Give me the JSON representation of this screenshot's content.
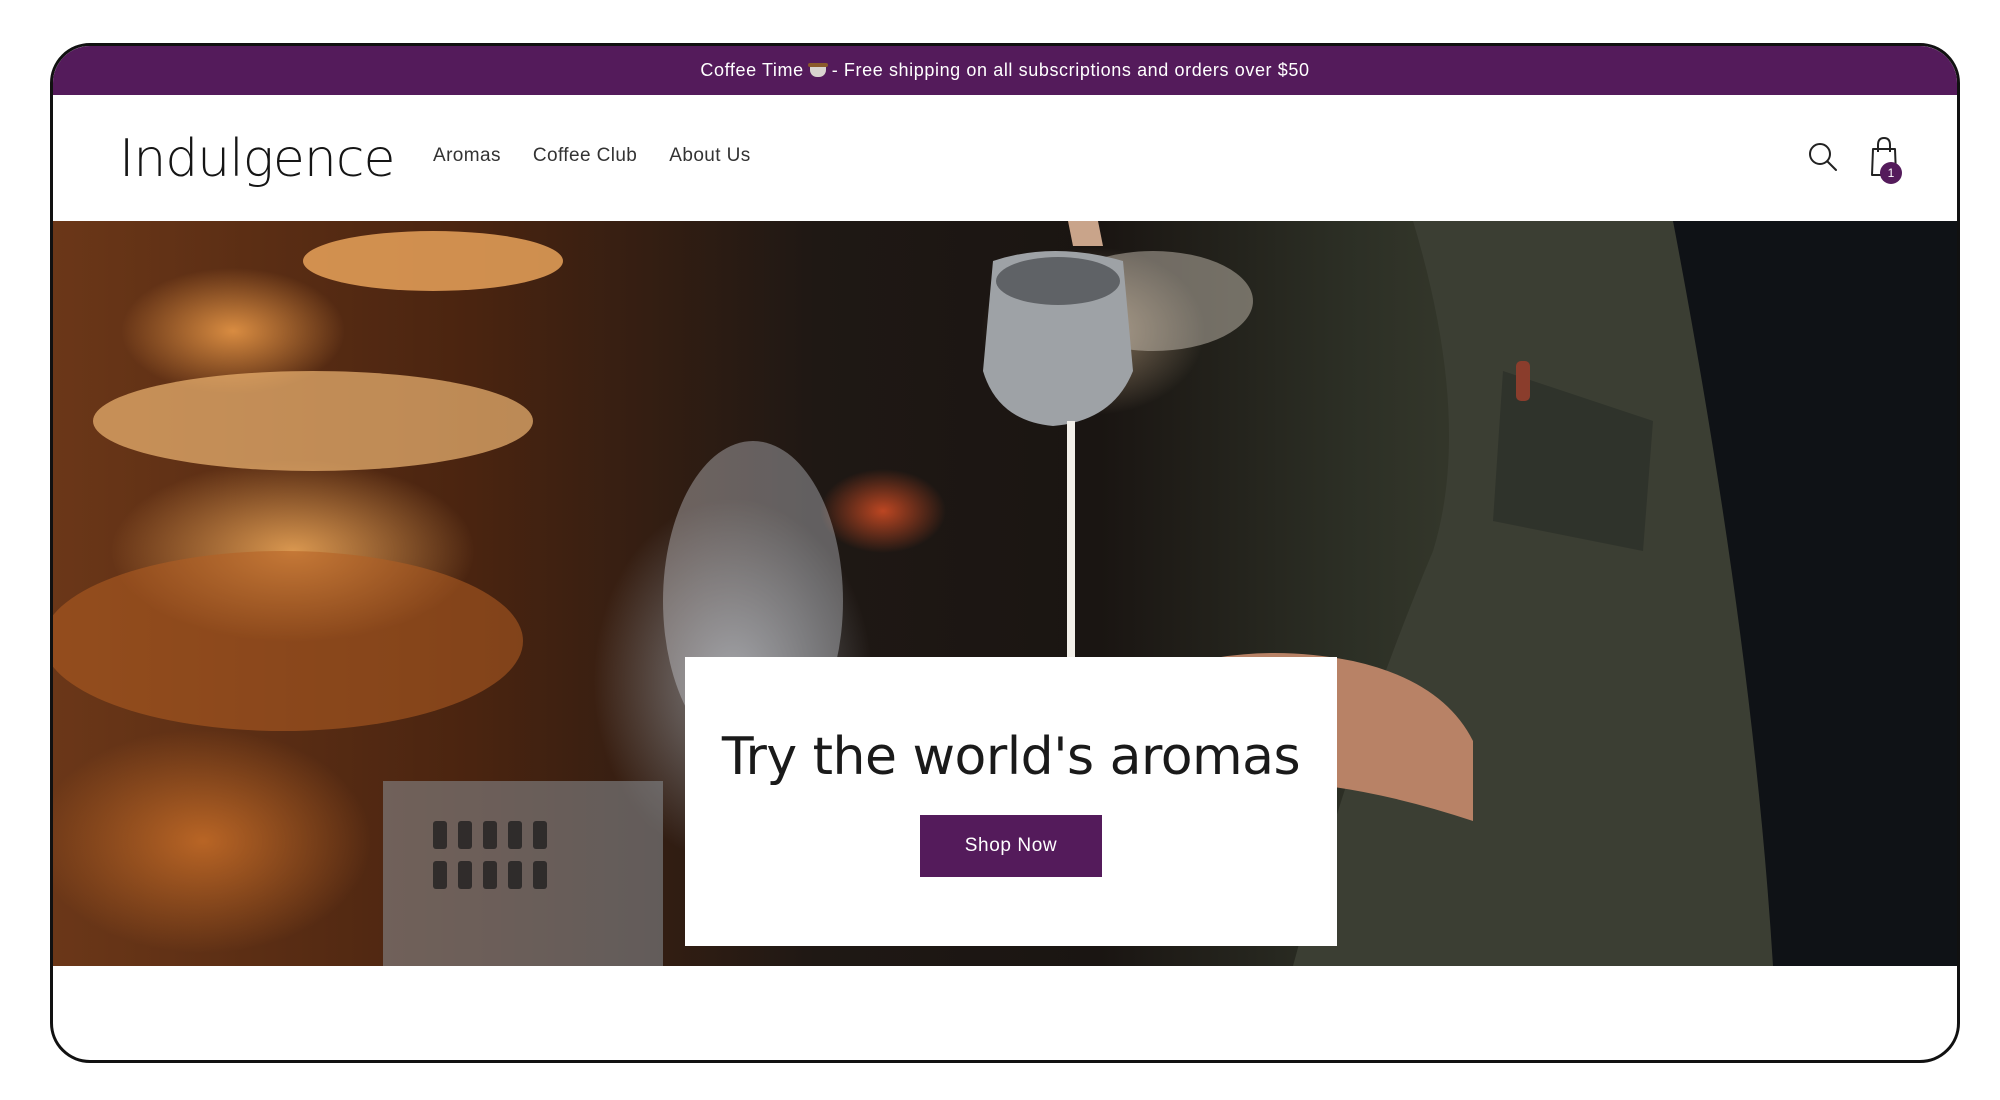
{
  "announcement": {
    "text_before": "Coffee Time",
    "icon": "coffee-cup-icon",
    "text_after": "- Free shipping on all subscriptions and orders over $50"
  },
  "header": {
    "logo": "Indulgence",
    "nav": [
      "Aromas",
      "Coffee Club",
      "About Us"
    ],
    "search_icon": "search-icon",
    "cart_icon": "shopping-bag-icon",
    "cart_count": "1"
  },
  "hero": {
    "heading": "Try the world's aromas",
    "button_label": "Shop Now"
  },
  "colors": {
    "brand": "#541b5b",
    "text": "#1a1a1a",
    "accent_underline": "#c6893f"
  }
}
